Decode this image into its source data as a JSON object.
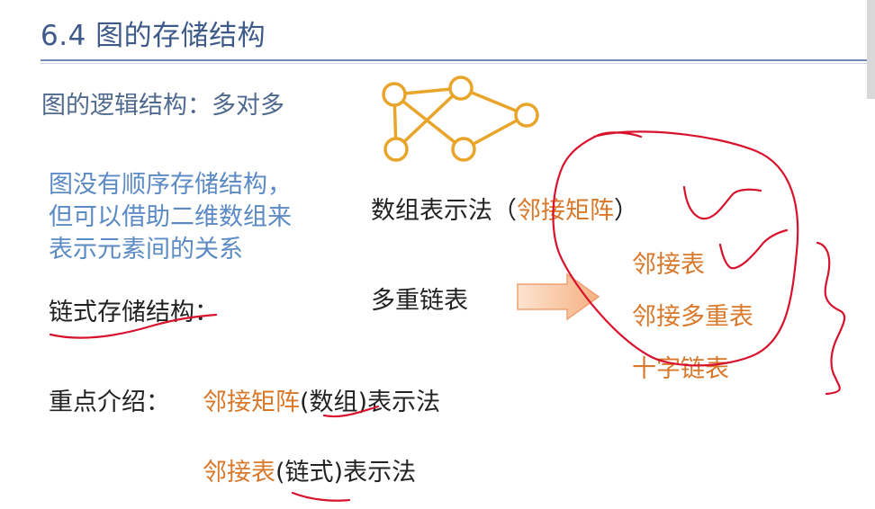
{
  "slide": {
    "title": "6.4 图的存储结构",
    "logic_structure": "图的逻辑结构：多对多",
    "no_sequential_lines": [
      "图没有顺序存储结构，",
      "但可以借助二维数组来",
      "表示元素间的关系"
    ],
    "chain_storage": "链式存储结构：",
    "array_method": {
      "prefix": "数组表示法（",
      "highlight": "邻接矩阵",
      "suffix": "）"
    },
    "multi_link": "多重链表",
    "options": [
      "邻接表",
      "邻接多重表",
      "十字链表"
    ],
    "focus_label": "重点介绍：",
    "focus_items": [
      {
        "highlight": "邻接矩阵",
        "plain": "(数组)表示法"
      },
      {
        "highlight": "邻接表",
        "plain": "(链式)表示法"
      }
    ]
  },
  "colors": {
    "title": "#3d5a8a",
    "logic_text": "#4f6a8e",
    "blue_text": "#5b8ac5",
    "orange_text": "#d9782a",
    "graph_node": "#e9a52a",
    "ink_annotation": "#d8122c",
    "arrow_fill": "#f5b183"
  },
  "icons": {
    "graph": "graph-diagram-icon",
    "arrow": "right-arrow-icon"
  }
}
